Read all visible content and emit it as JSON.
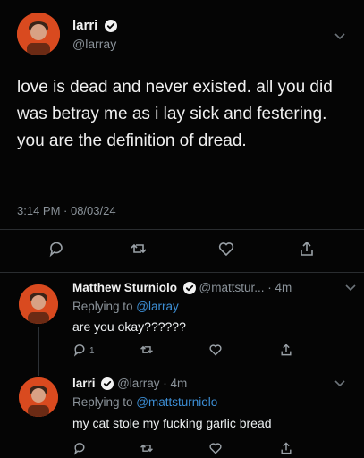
{
  "tweet": {
    "author_name": "larri",
    "author_handle": "@larray",
    "text": "love is dead and never existed. all you did was betray me as i lay sick and festering. you are the definition of dread.",
    "timestamp": "3:14 PM · 08/03/24"
  },
  "replies": [
    {
      "author_name": "Matthew Sturniolo",
      "handle_time": "@mattstur... · 4m",
      "replying_prefix": "Replying to ",
      "replying_to": "@larray",
      "text": "are you okay??????",
      "reply_count": "1"
    },
    {
      "author_name": "larri",
      "handle_time": "@larray · 4m",
      "replying_prefix": "Replying to ",
      "replying_to": "@mattsturniolo",
      "text": "my cat stole my fucking garlic bread"
    }
  ],
  "colors": {
    "background": "#050505",
    "accent": "#3d8fd6",
    "muted": "#8b939a",
    "avatar": "#d94a1f"
  },
  "icons": [
    "verified-icon",
    "chevron-down-icon",
    "reply-icon",
    "retweet-icon",
    "like-icon",
    "share-icon"
  ]
}
